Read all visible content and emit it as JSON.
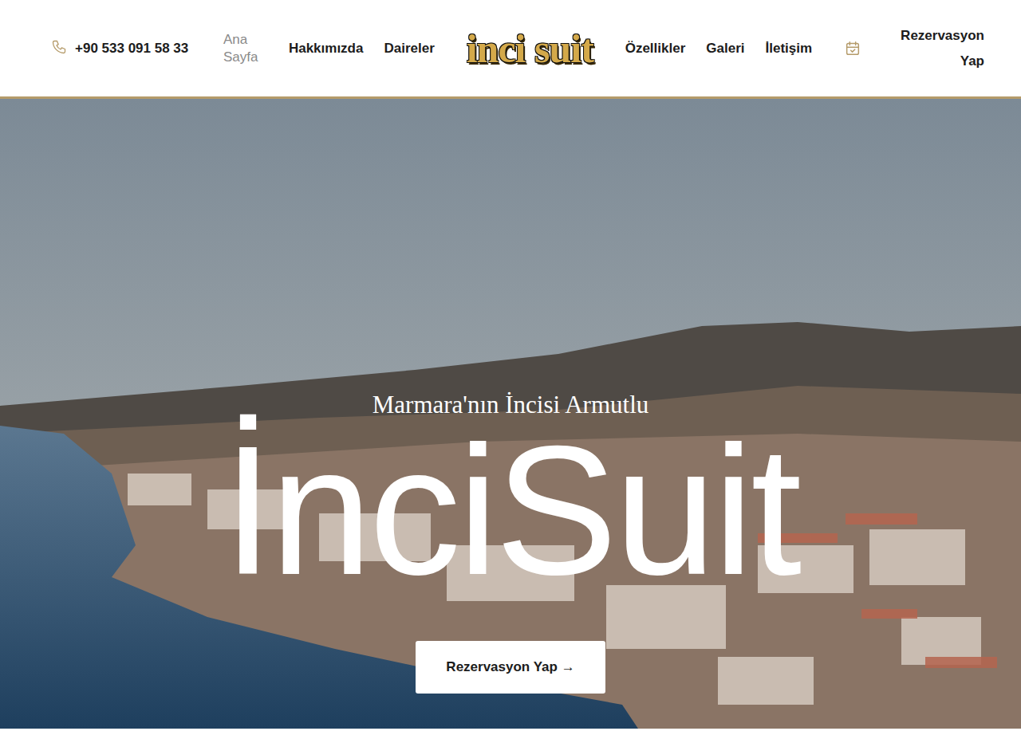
{
  "header": {
    "phone": "+90 533 091 58 33",
    "nav_left": [
      {
        "label": "Ana Sayfa",
        "selected": true
      },
      {
        "label": "Hakkımızda",
        "selected": false
      },
      {
        "label": "Daireler",
        "selected": false
      }
    ],
    "logo": "inci suit",
    "nav_right": [
      {
        "label": "Özellikler",
        "selected": false
      },
      {
        "label": "Galeri",
        "selected": false
      },
      {
        "label": "İletişim",
        "selected": false
      }
    ],
    "reserve": "Rezervasyon Yap"
  },
  "hero": {
    "subtitle": "Marmara'nın İncisi Armutlu",
    "title": "İnciSuit",
    "button": "Rezervasyon Yap →"
  }
}
